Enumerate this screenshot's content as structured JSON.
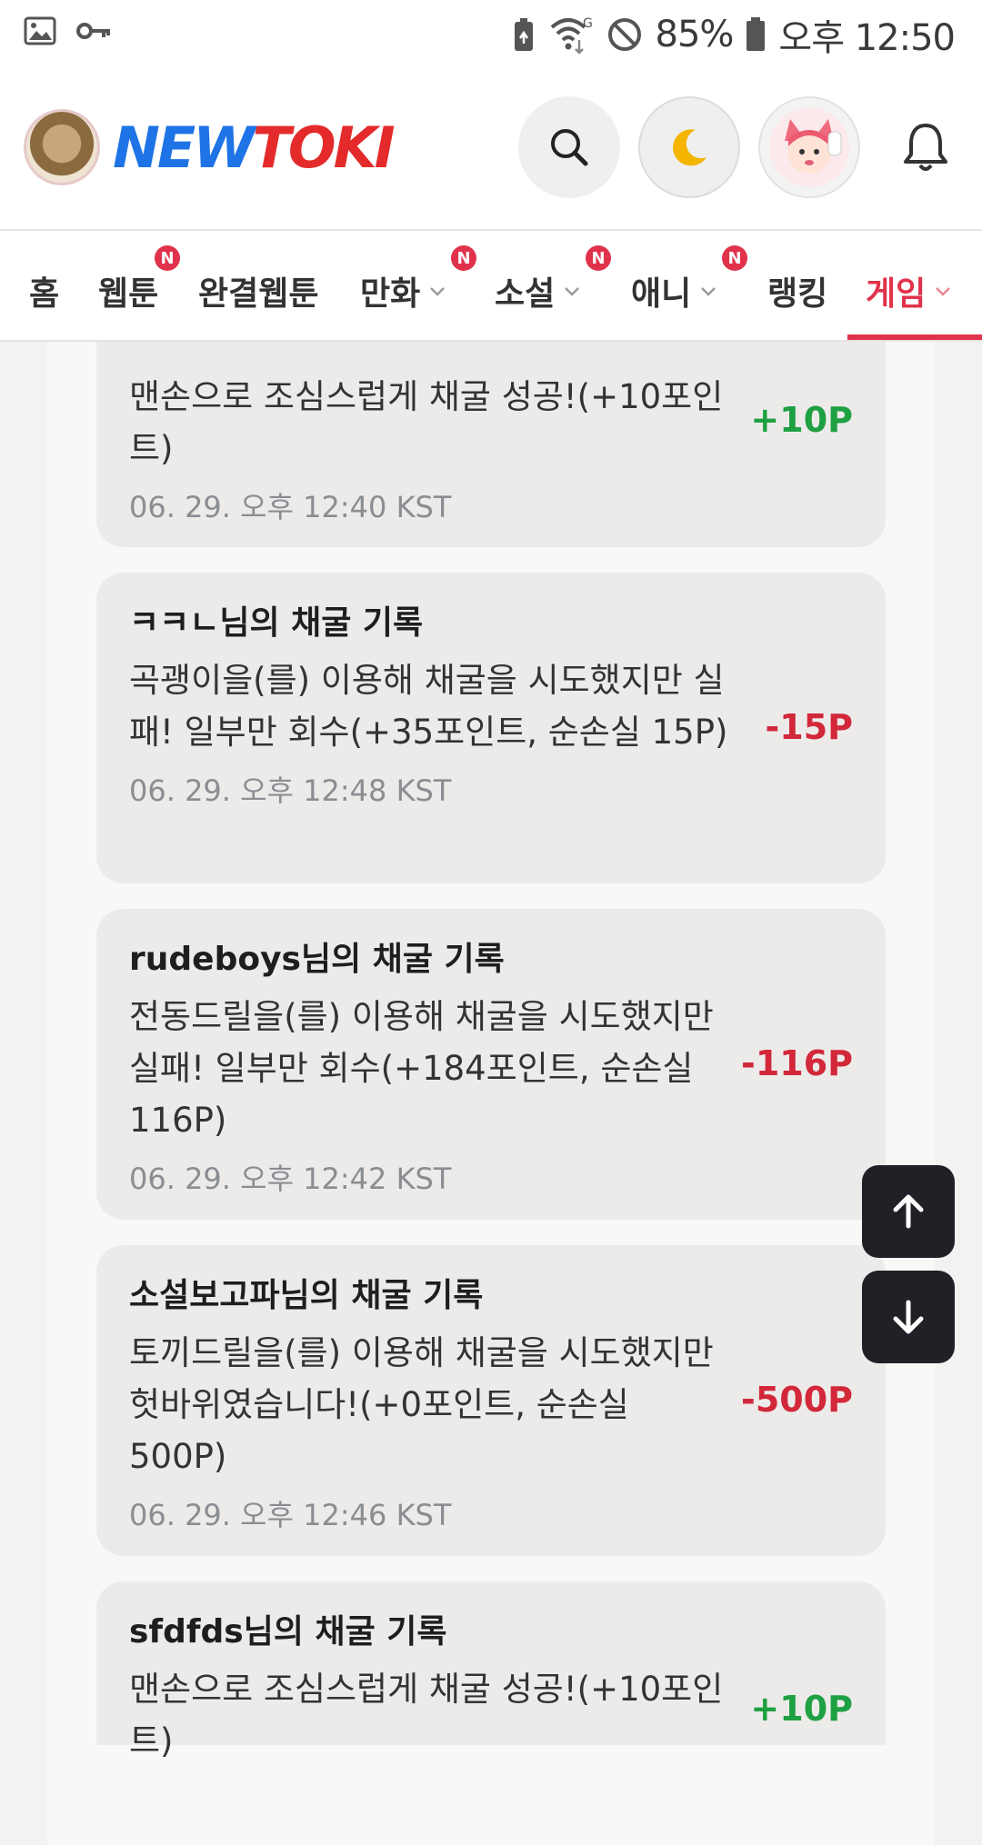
{
  "status_bar": {
    "battery": "85%",
    "time": "오후 12:50",
    "icons": [
      "gallery-icon",
      "key-icon",
      "battery-saver-icon",
      "wifi-icon",
      "do-not-disturb-icon",
      "battery-icon"
    ]
  },
  "header": {
    "logo_new": "NEW",
    "logo_toki": "TOKI",
    "icons": [
      "search-icon",
      "moon-icon",
      "profile-avatar",
      "bell-icon"
    ]
  },
  "nav": {
    "items": [
      {
        "label": "홈"
      },
      {
        "label": "웹툰",
        "badge": "N"
      },
      {
        "label": "완결웹툰"
      },
      {
        "label": "만화",
        "badge": "N"
      },
      {
        "label": "소설",
        "badge": "N"
      },
      {
        "label": "애니",
        "badge": "N"
      },
      {
        "label": "랭킹"
      },
      {
        "label": "게임"
      }
    ],
    "active": "게임",
    "accent_color": "#e0334b"
  },
  "records": [
    {
      "title": "",
      "desc": "맨손으로 조심스럽게 채굴 성공!(+10포인트)",
      "time": "06. 29. 오후 12:40 KST",
      "points": "+10P"
    },
    {
      "title": "ㅋㅋㄴ님의 채굴 기록",
      "desc": "곡괭이을(를) 이용해 채굴을 시도했지만 실패! 일부만 회수(+35포인트, 순손실 15P)",
      "time": "06. 29. 오후 12:48 KST",
      "points": "-15P"
    },
    {
      "title": "rudeboys님의 채굴 기록",
      "desc": "전동드릴을(를) 이용해 채굴을 시도했지만 실패! 일부만 회수(+184포인트, 순손실 116P)",
      "time": "06. 29. 오후 12:42 KST",
      "points": "-116P"
    },
    {
      "title": "소설보고파님의 채굴 기록",
      "desc": "토끼드릴을(를) 이용해 채굴을 시도했지만 헛바위였습니다!(+0포인트, 순손실 500P)",
      "time": "06. 29. 오후 12:46 KST",
      "points": "-500P"
    },
    {
      "title": "sfdfds님의 채굴 기록",
      "desc": "맨손으로 조심스럽게 채굴 성공!(+10포인트)",
      "time": "",
      "points": "+10P"
    }
  ],
  "colors": {
    "positive": "#1fa042",
    "negative": "#d2283a"
  },
  "fab": [
    "arrow-up-icon",
    "arrow-down-icon"
  ]
}
